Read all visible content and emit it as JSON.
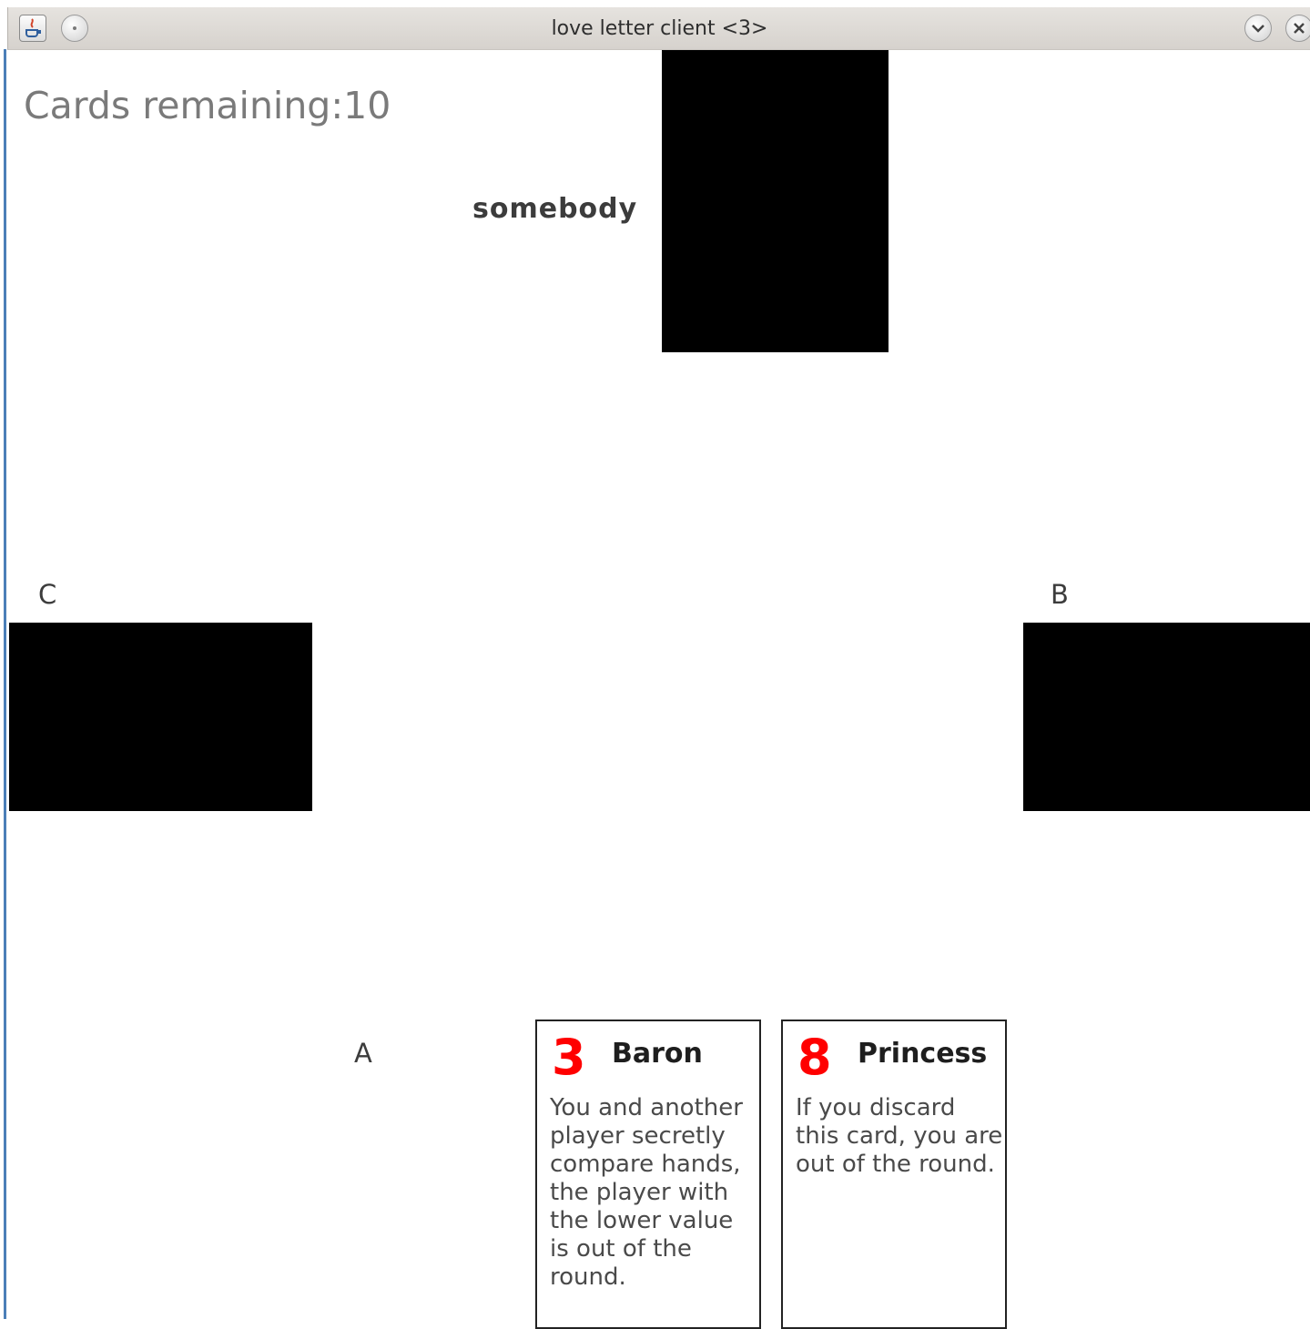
{
  "window": {
    "title": "love letter client <3>",
    "icons": [
      "java-app-icon",
      "menu-circle-icon",
      "minimize-chevron-icon",
      "close-x-icon"
    ]
  },
  "game": {
    "cards_remaining_label": "Cards remaining:10",
    "cards_remaining": 10
  },
  "players": {
    "top": {
      "name": "somebody"
    },
    "left": {
      "name": "C"
    },
    "right": {
      "name": "B"
    },
    "bottom": {
      "name": "A"
    }
  },
  "hand": [
    {
      "value": "3",
      "name": "Baron",
      "text": "You and another player secretly compare hands, the player with the lower value is out of the round."
    },
    {
      "value": "8",
      "name": "Princess",
      "text": "If you discard this card, you are out of the round."
    }
  ],
  "colors": {
    "card_value": "#ff0000",
    "card_back": "#000000",
    "cards_remaining_text": "#7a7a7a"
  }
}
